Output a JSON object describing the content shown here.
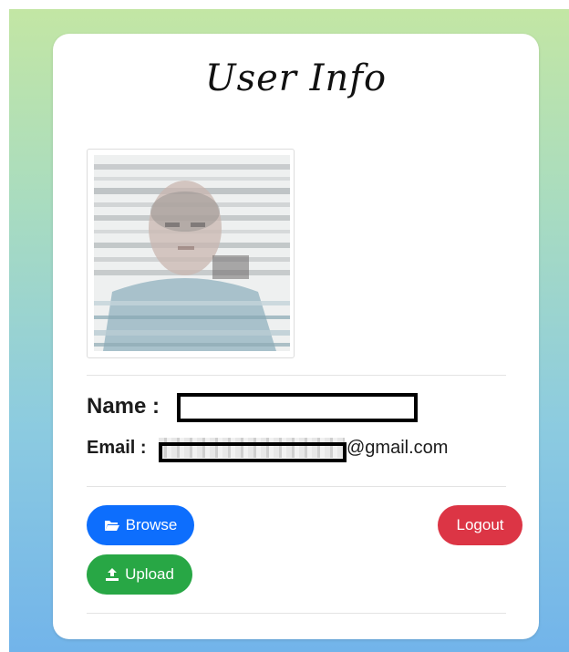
{
  "card": {
    "title": "User Info"
  },
  "profile": {
    "name_label": "Name :",
    "email_label": "Email :",
    "email_domain": "@gmail.com"
  },
  "actions": {
    "browse_label": "Browse",
    "upload_label": "Upload",
    "logout_label": "Logout"
  },
  "icons": {
    "browse": "folder-open-icon",
    "upload": "upload-icon"
  },
  "colors": {
    "browse": "#0d6efd",
    "upload": "#28a745",
    "logout": "#dc3545"
  }
}
